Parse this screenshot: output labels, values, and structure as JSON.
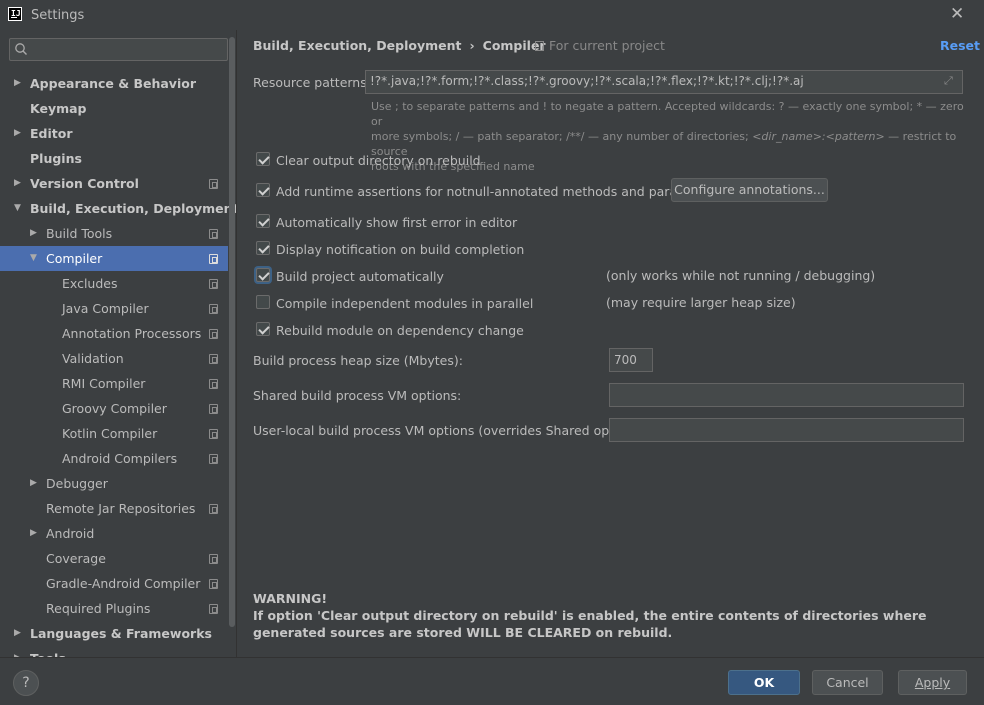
{
  "window": {
    "title": "Settings",
    "app_icon_text": "IJ"
  },
  "search": {
    "placeholder": "",
    "value": ""
  },
  "sidebar": {
    "items": [
      {
        "label": "Appearance & Behavior",
        "arrow": "▶",
        "bold": true
      },
      {
        "label": "Keymap",
        "bold": true
      },
      {
        "label": "Editor",
        "arrow": "▶",
        "bold": true
      },
      {
        "label": "Plugins",
        "bold": true
      },
      {
        "label": "Version Control",
        "arrow": "▶",
        "bold": true,
        "project": true
      },
      {
        "label": "Build, Execution, Deployment",
        "arrow": "▼",
        "bold": true
      },
      {
        "label": "Build Tools",
        "arrow": "▶",
        "project": true
      },
      {
        "label": "Compiler",
        "arrow": "▼",
        "project": true,
        "selected": true
      },
      {
        "label": "Excludes",
        "project": true
      },
      {
        "label": "Java Compiler",
        "project": true
      },
      {
        "label": "Annotation Processors",
        "project": true
      },
      {
        "label": "Validation",
        "project": true
      },
      {
        "label": "RMI Compiler",
        "project": true
      },
      {
        "label": "Groovy Compiler",
        "project": true
      },
      {
        "label": "Kotlin Compiler",
        "project": true
      },
      {
        "label": "Android Compilers",
        "project": true
      },
      {
        "label": "Debugger",
        "arrow": "▶"
      },
      {
        "label": "Remote Jar Repositories",
        "project": true
      },
      {
        "label": "Android",
        "arrow": "▶"
      },
      {
        "label": "Coverage",
        "project": true
      },
      {
        "label": "Gradle-Android Compiler",
        "project": true
      },
      {
        "label": "Required Plugins",
        "project": true
      },
      {
        "label": "Languages & Frameworks",
        "arrow": "▶",
        "bold": true
      },
      {
        "label": "Tools",
        "arrow": "▶",
        "bold": true
      }
    ]
  },
  "header": {
    "crumb_parent": "Build, Execution, Deployment",
    "crumb_sep": "›",
    "crumb_current": "Compiler",
    "scope": "For current project",
    "reset": "Reset"
  },
  "resource": {
    "label": "Resource patterns:",
    "value": "!?*.java;!?*.form;!?*.class;!?*.groovy;!?*.scala;!?*.flex;!?*.kt;!?*.clj;!?*.aj",
    "hint_line1": "Use ; to separate patterns and ! to negate a pattern. Accepted wildcards: ? — exactly one symbol; * — zero or",
    "hint_line2_a": "more symbols; / — path separator; /**/ — any number of directories; ",
    "hint_line2_b": "<dir_name>:<pattern>",
    "hint_line2_c": " — restrict to source",
    "hint_line3": "roots with the specified name"
  },
  "options": {
    "clear_output": {
      "label": "Clear output directory on rebuild",
      "checked": true
    },
    "runtime_assertions": {
      "label": "Add runtime assertions for notnull-annotated methods and parameters",
      "checked": true
    },
    "configure_annotations": "Configure annotations...",
    "show_first_error": {
      "label": "Automatically show first error in editor",
      "checked": true
    },
    "display_notification": {
      "label": "Display notification on build completion",
      "checked": true
    },
    "build_auto": {
      "label": "Build project automatically",
      "checked": true,
      "note": "(only works while not running / debugging)"
    },
    "compile_parallel": {
      "label": "Compile independent modules in parallel",
      "checked": false,
      "note": "(may require larger heap size)"
    },
    "rebuild_on_change": {
      "label": "Rebuild module on dependency change",
      "checked": true
    }
  },
  "heap": {
    "label": "Build process heap size (Mbytes):",
    "value": "700"
  },
  "shared_vm": {
    "label": "Shared build process VM options:",
    "value": ""
  },
  "user_vm": {
    "label": "User-local build process VM options (overrides Shared options):",
    "value": ""
  },
  "warning": {
    "title": "WARNING!",
    "text": "If option 'Clear output directory on rebuild' is enabled, the entire contents of directories where generated sources are stored WILL BE CLEARED on rebuild."
  },
  "footer": {
    "help": "?",
    "ok": "OK",
    "cancel": "Cancel",
    "apply": "Apply"
  },
  "colors": {
    "accent": "#4b6eaf",
    "link": "#589df6",
    "primary_button": "#365880",
    "background": "#3c3f41"
  }
}
